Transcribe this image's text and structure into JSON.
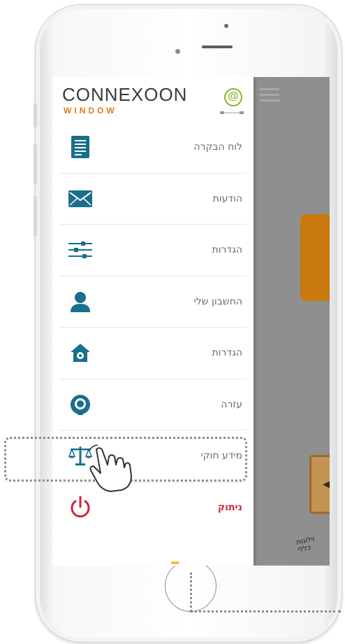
{
  "logo": {
    "brand": "CONNEXOON",
    "product": "WINDOW",
    "at_symbol": "@"
  },
  "menu": [
    {
      "label": "לוח הבקרה",
      "icon": "document-icon",
      "style": "normal"
    },
    {
      "label": "הודעות",
      "icon": "envelope-icon",
      "style": "normal"
    },
    {
      "label": "הגדרות",
      "icon": "sliders-icon",
      "style": "normal"
    },
    {
      "label": "החשבון שלי",
      "icon": "user-icon",
      "style": "normal"
    },
    {
      "label": "הגדרות",
      "icon": "house-gear-icon",
      "style": "normal"
    },
    {
      "label": "עזרה",
      "icon": "headset-icon",
      "style": "normal"
    },
    {
      "label": "מידע חוקי",
      "icon": "scales-icon",
      "style": "normal"
    },
    {
      "label": "ניתוק",
      "icon": "power-icon",
      "style": "danger"
    }
  ],
  "background_app": {
    "tile_label": "וילונות כללי"
  },
  "colors": {
    "brand_gray": "#3a3a3a",
    "brand_orange": "#e07b1c",
    "icon_teal": "#1a6e8e",
    "danger_red": "#d0243a",
    "at_green": "#8bb52c"
  }
}
